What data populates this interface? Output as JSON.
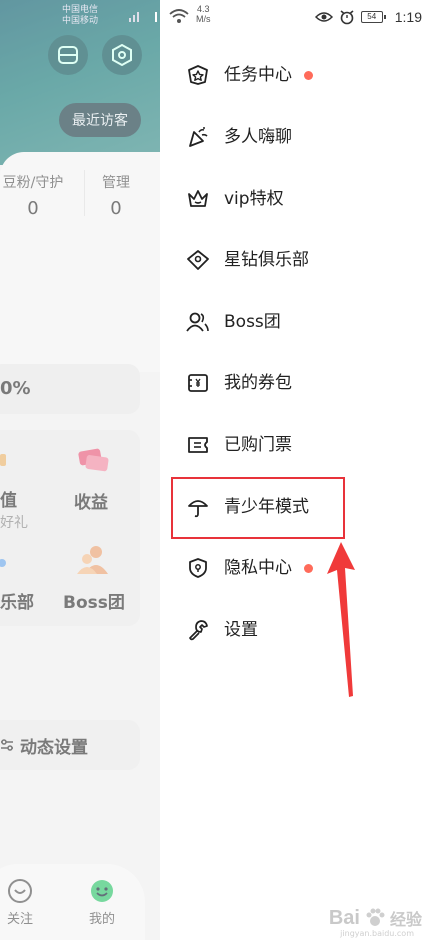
{
  "background_page": {
    "status_carrier_1": "中国电信",
    "status_carrier_2": "中国移动",
    "status_network_speed": "4.3",
    "status_network_unit": "M/s",
    "recent_visitors_label": "最近访客",
    "stats": [
      {
        "label": "豆粉/守护",
        "value": "0"
      },
      {
        "label": "管理",
        "value": "0"
      }
    ],
    "percent_text": "0%",
    "features": [
      {
        "label": "值",
        "sub": "好礼"
      },
      {
        "label": "收益",
        "sub": ""
      },
      {
        "label": "乐部",
        "sub": ""
      },
      {
        "label": "Boss团",
        "sub": ""
      }
    ],
    "dynamic_settings_label": "动态设置",
    "tabs": [
      {
        "label": "关注",
        "icon": "heart-face-icon"
      },
      {
        "label": "我的",
        "icon": "smile-face-icon"
      }
    ]
  },
  "status_bar": {
    "time": "1:19",
    "battery": "54"
  },
  "drawer_menu": {
    "items": [
      {
        "label": "任务中心",
        "icon": "star-shield-icon",
        "badge": true
      },
      {
        "label": "多人嗨聊",
        "icon": "party-popper-icon",
        "badge": false
      },
      {
        "label": "vip特权",
        "icon": "crown-icon",
        "badge": false
      },
      {
        "label": "星钻俱乐部",
        "icon": "diamond-icon",
        "badge": false
      },
      {
        "label": "Boss团",
        "icon": "users-icon",
        "badge": false
      },
      {
        "label": "我的券包",
        "icon": "coupon-icon",
        "badge": false
      },
      {
        "label": "已购门票",
        "icon": "ticket-icon",
        "badge": false
      },
      {
        "label": "青少年模式",
        "icon": "umbrella-icon",
        "badge": false
      },
      {
        "label": "隐私中心",
        "icon": "privacy-shield-icon",
        "badge": true
      },
      {
        "label": "设置",
        "icon": "wrench-icon",
        "badge": false
      }
    ]
  },
  "watermark": {
    "brand": "Bai",
    "brand_cn": "经验",
    "url": "jingyan.baidu.com"
  },
  "colors": {
    "accent_dot": "#ff6b5a",
    "highlight_red": "#e8323a"
  }
}
